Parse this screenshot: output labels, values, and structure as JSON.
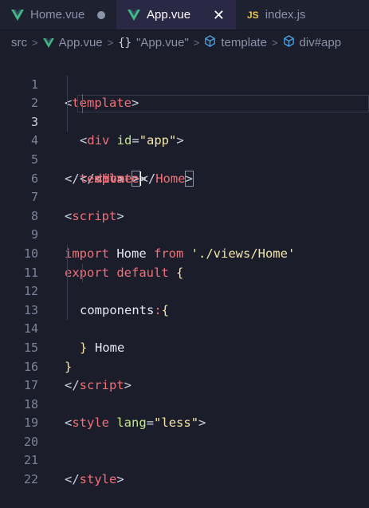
{
  "tabs": [
    {
      "label": "Home.vue",
      "icon": "vue-icon",
      "state": "modified"
    },
    {
      "label": "App.vue",
      "icon": "vue-icon",
      "state": "active"
    },
    {
      "label": "index.js",
      "icon": "js-icon",
      "icon_text": "JS",
      "state": "normal"
    }
  ],
  "close_glyph": "✕",
  "breadcrumb": {
    "src": "src",
    "file": "App.vue",
    "braces": "{}",
    "component": "\"App.vue\"",
    "template": "template",
    "div": "div#app"
  },
  "lines": {
    "n1": "1",
    "n2": "2",
    "n3": "3",
    "n4": "4",
    "n5": "5",
    "n6": "6",
    "n7": "7",
    "n8": "8",
    "n9": "9",
    "n10": "10",
    "n11": "11",
    "n12": "12",
    "n13": "13",
    "n14": "14",
    "n15": "15",
    "n16": "16",
    "n17": "17",
    "n18": "18",
    "n19": "19",
    "n20": "20",
    "n21": "21",
    "n22": "22"
  },
  "code": {
    "l1_lt": "<",
    "l1_tag": "template",
    "l1_gt": ">",
    "l2_lt": "<",
    "l2_tag": "div",
    "l2_attr": " id",
    "l2_eq": "=",
    "l2_val": "\"app\"",
    "l2_gt": ">",
    "l3_lt": "<",
    "l3_tag": "Home",
    "l3_gt": ">",
    "l3_close_lt": "</",
    "l3_close_tag": "Home",
    "l3_close_gt": ">",
    "l4_lt": "</",
    "l4_tag": "div",
    "l4_gt": ">",
    "l5_lt": "</",
    "l5_tag": "template",
    "l5_gt": ">",
    "l7_lt": "<",
    "l7_tag": "script",
    "l7_gt": ">",
    "l9_import": "import",
    "l9_name": " Home ",
    "l9_from": "from",
    "l9_path": " './views/Home'",
    "l10_export": "export",
    "l10_default": " default",
    "l10_brace": " {",
    "l11_key": "components",
    "l11_colon": ":",
    "l11_brace": "{",
    "l12_name": "Home",
    "l13_brace": "}",
    "l15_brace": "}",
    "l16_lt": "</",
    "l16_tag": "script",
    "l16_gt": ">",
    "l18_lt": "<",
    "l18_tag": "style",
    "l18_attr": " lang",
    "l18_eq": "=",
    "l18_val": "\"less\"",
    "l18_gt": ">",
    "l21_lt": "</",
    "l21_tag": "style",
    "l21_gt": ">"
  },
  "colors": {
    "background": "#1b1d2b",
    "tag": "#f07178",
    "attribute": "#c3e88d",
    "string": "#f5e6a6",
    "vue_green": "#41b883",
    "js_yellow": "#e6c34a"
  }
}
